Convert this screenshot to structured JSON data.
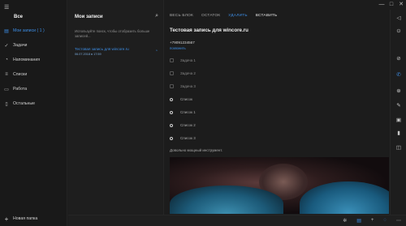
{
  "window": {
    "controls": [
      "—",
      "□",
      "✕"
    ]
  },
  "nav": {
    "all": "Все",
    "items": [
      {
        "label": "Мои записи ( 1 )",
        "icon": "notes-icon",
        "glyph": "▤",
        "active": true
      },
      {
        "label": "Задачи",
        "icon": "check-icon",
        "glyph": "✓",
        "active": false
      },
      {
        "label": "Напоминания",
        "icon": "bell-icon",
        "glyph": "◔",
        "active": false
      },
      {
        "label": "Списки",
        "icon": "list-icon",
        "glyph": "≡",
        "active": false
      },
      {
        "label": "Работа",
        "icon": "folder-icon",
        "glyph": "▭",
        "active": false
      },
      {
        "label": "Остальные",
        "icon": "document-icon",
        "glyph": "▯",
        "active": false
      }
    ],
    "new_folder": "Новая папка"
  },
  "list": {
    "title": "Мои записи",
    "hint": "Используйте поиск, чтобы отобразить больше записей...",
    "note": {
      "title": "Тестовая запись для wincore.ru",
      "date": "06.07.2018 в 17:59"
    }
  },
  "toolbar": {
    "select_all": "ВЕСЬ БЛОК",
    "cut": "ОСТАТОК",
    "delete": "УДАЛИТЬ",
    "paste": "ВСТАВИТЬ"
  },
  "editor": {
    "title": "Тестовая запись для wincore.ru",
    "phone": "+79091234567",
    "call": "позвонить",
    "tasks": [
      "Задача 1",
      "Задача 2",
      "Задача 3"
    ],
    "bullets": [
      "Список",
      "Список 1",
      "Список 2",
      "Список 3"
    ],
    "footer": "Довольно мощный инструмент."
  },
  "status": {
    "icons": [
      "settings-icon",
      "notes-icon",
      "add-icon",
      "sync-icon",
      "menu-icon"
    ]
  },
  "rail": {
    "icons": [
      "back-icon",
      "record-icon",
      "check-icon",
      "phone-icon",
      "globe-icon",
      "pen-icon",
      "image-icon",
      "mic-icon",
      "camera-icon"
    ]
  },
  "accent": "#3d8ee6"
}
